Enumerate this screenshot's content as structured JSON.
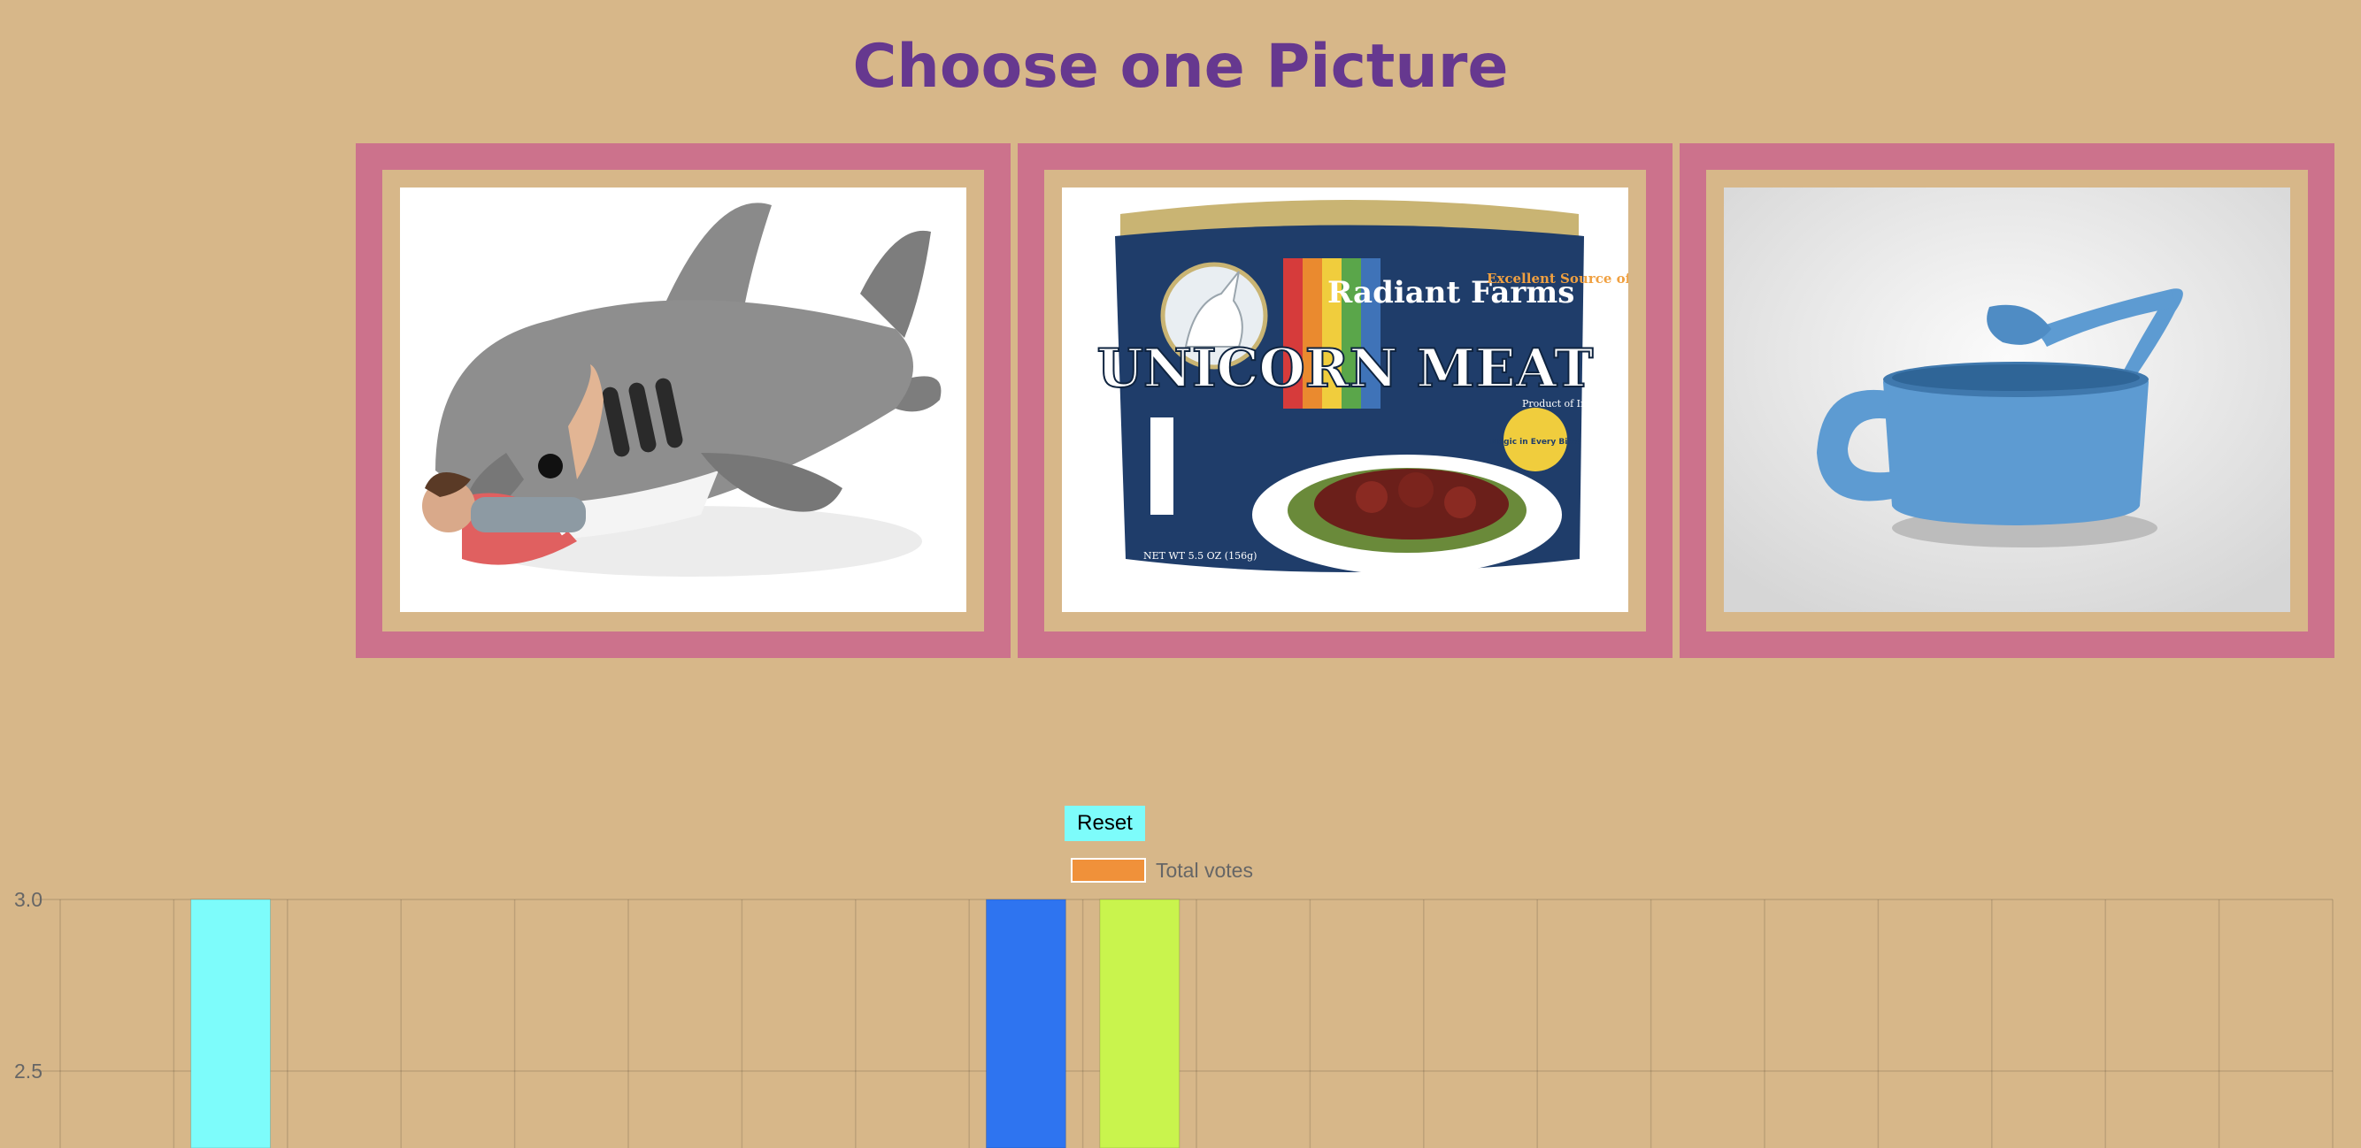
{
  "page": {
    "title": "Choose one Picture"
  },
  "pictures": [
    {
      "name": "shark sleeping bag",
      "can_brand": "",
      "can_title": "",
      "can_tagline": ""
    },
    {
      "name": "unicorn meat can",
      "can_brand": "Radiant Farms",
      "can_title": "UNICORN MEAT",
      "can_tagline": "Excellent Source of Sparkles",
      "can_badge": "Magic in Every Bite!",
      "can_origin": "Product of Ireland",
      "can_weight": "NET WT 5.5 OZ (156g)"
    },
    {
      "name": "watering can"
    }
  ],
  "controls": {
    "reset_label": "Reset"
  },
  "chart_data": {
    "type": "bar",
    "legend": {
      "label": "Total votes",
      "color": "#f0913a",
      "position": "top"
    },
    "y_ticks": [
      "3.0",
      "2.5"
    ],
    "ylim": [
      2.3,
      3.0
    ],
    "grid": true,
    "categories": 20,
    "values": [
      null,
      3,
      null,
      null,
      null,
      null,
      null,
      null,
      3,
      3,
      null,
      null,
      null,
      null,
      null,
      null,
      null,
      null,
      null,
      null
    ],
    "bar_colors": [
      null,
      "#7dfcfb",
      null,
      null,
      null,
      null,
      null,
      null,
      "#2e74f0",
      "#c9f44d",
      null,
      null,
      null,
      null,
      null,
      null,
      null,
      null,
      null,
      null
    ]
  },
  "colors": {
    "background": "#d7b789",
    "title": "#66388f",
    "frame": "#cc728c",
    "reset_button": "#7dfcfb"
  }
}
